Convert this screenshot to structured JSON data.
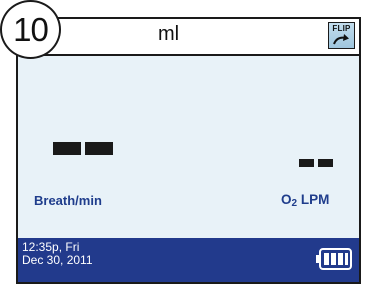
{
  "step_number": "10",
  "header": {
    "unit_label": "ml",
    "flip_label": "FLIP"
  },
  "readings": {
    "left_label": "Breath/min",
    "right_label_main": "O",
    "right_label_sub": "2",
    "right_label_suffix": " LPM"
  },
  "status": {
    "time": "12:35p, Fri",
    "date": "Dec 30, 2011",
    "battery_level": 1.0
  },
  "colors": {
    "screen_bg": "#e8f2f8",
    "status_bg": "#223a8c",
    "label": "#1f3d8c"
  }
}
